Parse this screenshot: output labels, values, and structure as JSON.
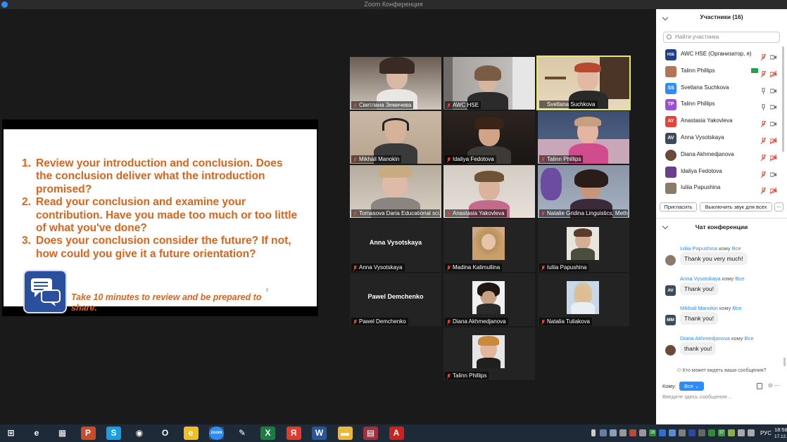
{
  "window": {
    "title": "Zoom Конференция"
  },
  "slide": {
    "items": [
      {
        "num": "1.",
        "text": "Review your introduction and conclusion. Does the conclusion deliver what the introduction promised?"
      },
      {
        "num": "2.",
        "text": "Read your conclusion and examine your contribution. Have you made too much or too little of what you've done?"
      },
      {
        "num": "3.",
        "text": "Does your conclusion consider the future? If not, how could you give it a future orientation?"
      }
    ],
    "note": "Take 10 minutes to review and be prepared to share."
  },
  "videos": [
    {
      "name": "Светлана Земичева"
    },
    {
      "name": "AWC HSE"
    },
    {
      "name": "Svetlana Suchkova"
    },
    {
      "name": "Mikhail Manokin"
    },
    {
      "name": "Idaliya Fedotova"
    },
    {
      "name": "Talinn Phillips"
    },
    {
      "name": "Tomasova Daria Educational sci..."
    },
    {
      "name": "Anastasia Yakovleva"
    },
    {
      "name": "Natalie Gridina Linguistics, Meth..."
    },
    {
      "name": "Anna Vysotskaya",
      "big": "Anna Vysotskaya"
    },
    {
      "name": "Madina Kalimullina"
    },
    {
      "name": "Iuliia Papushina"
    },
    {
      "name": "Pawel Demchenko",
      "big": "Pawel Demchenko"
    },
    {
      "name": "Diana Akhmedjanova"
    },
    {
      "name": "Natalia Tuliakova"
    },
    {
      "name": "Talinn Phillips"
    }
  ],
  "participants": {
    "header": "Участники (16)",
    "search_placeholder": "Найти участника",
    "list": [
      {
        "name": "AWC HSE (Организатор, я)",
        "initials": "",
        "color": "#1f3f8a"
      },
      {
        "name": "Talinn Phillips",
        "initials": "",
        "color": "#b07656"
      },
      {
        "name": "Svetlana Suchkova",
        "initials": "SS",
        "color": "#2d8cff"
      },
      {
        "name": "Talinn Phillips",
        "initials": "TP",
        "color": "#9b4fd1"
      },
      {
        "name": "Anastasia Yakovleva",
        "initials": "AY",
        "color": "#e2463a"
      },
      {
        "name": "Anna Vysotskaya",
        "initials": "AV",
        "color": "#3d4a5a"
      },
      {
        "name": "Diana Akhmedjanova",
        "initials": "",
        "color": "#6b4a3a"
      },
      {
        "name": "Idaliya Fedotova",
        "initials": "",
        "color": "#6a3f8e"
      },
      {
        "name": "Iuliia Papushina",
        "initials": "",
        "color": "#8a7a6a"
      }
    ],
    "invite_label": "Пригласить",
    "mute_all_label": "Выключить звук для всех",
    "more_label": "..."
  },
  "chat": {
    "header": "Чат конференции",
    "to_word": "кому",
    "messages": [
      {
        "sender": "Iuliia Papushina",
        "to": "Все",
        "text": "Thank you very much!",
        "initials": "",
        "color": "#8a7a6a"
      },
      {
        "sender": "Anna Vysotskaya",
        "to": "Все",
        "text": "Thank you!",
        "initials": "AV",
        "color": "#3d4a5a"
      },
      {
        "sender": "Mikhail Manokin",
        "to": "Все",
        "text": "Thank you!",
        "initials": "MM",
        "color": "#3d4a5a"
      },
      {
        "sender": "Diana Akhmedjanova",
        "to": "Все",
        "text": "thank you!",
        "initials": "",
        "color": "#6b4a3a"
      }
    ],
    "who_can_see": "Кто может видеть ваши сообщения?",
    "to_label": "Кому:",
    "to_value": "Все",
    "placeholder": "Введите здесь сообщение..."
  },
  "taskbar": {
    "icons": [
      {
        "name": "windows-start-icon",
        "glyph": "⊞",
        "color": "transparent"
      },
      {
        "name": "internet-explorer-icon",
        "glyph": "e",
        "color": "transparent"
      },
      {
        "name": "calculator-icon",
        "glyph": "▦",
        "color": "transparent"
      },
      {
        "name": "powerpoint-icon",
        "glyph": "P",
        "color": "#c84b2b"
      },
      {
        "name": "skype-icon",
        "glyph": "S",
        "color": "#1a9ee0"
      },
      {
        "name": "chrome-icon",
        "glyph": "◉",
        "color": "transparent"
      },
      {
        "name": "opera-icon",
        "glyph": "O",
        "color": "transparent"
      },
      {
        "name": "efanel-icon",
        "glyph": "e",
        "color": "#f0c020"
      },
      {
        "name": "zoom-icon",
        "glyph": "zoom",
        "color": "#2d8cff"
      },
      {
        "name": "paint-icon",
        "glyph": "✎",
        "color": "transparent"
      },
      {
        "name": "excel-icon",
        "glyph": "X",
        "color": "#1f7a43"
      },
      {
        "name": "yandex-icon",
        "glyph": "Я",
        "color": "#e23a2e"
      },
      {
        "name": "word-icon",
        "glyph": "W",
        "color": "#2a5699"
      },
      {
        "name": "file-explorer-icon",
        "glyph": "▬",
        "color": "#e8b93c"
      },
      {
        "name": "winrar-icon",
        "glyph": "▤",
        "color": "#a03040"
      },
      {
        "name": "acrobat-icon",
        "glyph": "A",
        "color": "#c8241e"
      }
    ],
    "tray_numbers": [
      "28",
      "37"
    ],
    "lang": "РУС",
    "time": "18:58",
    "date": "17.12.2022"
  },
  "colors": {
    "accent": "#2d8cff",
    "slide_text": "#d9651c",
    "active_border": "#e6ea64"
  }
}
